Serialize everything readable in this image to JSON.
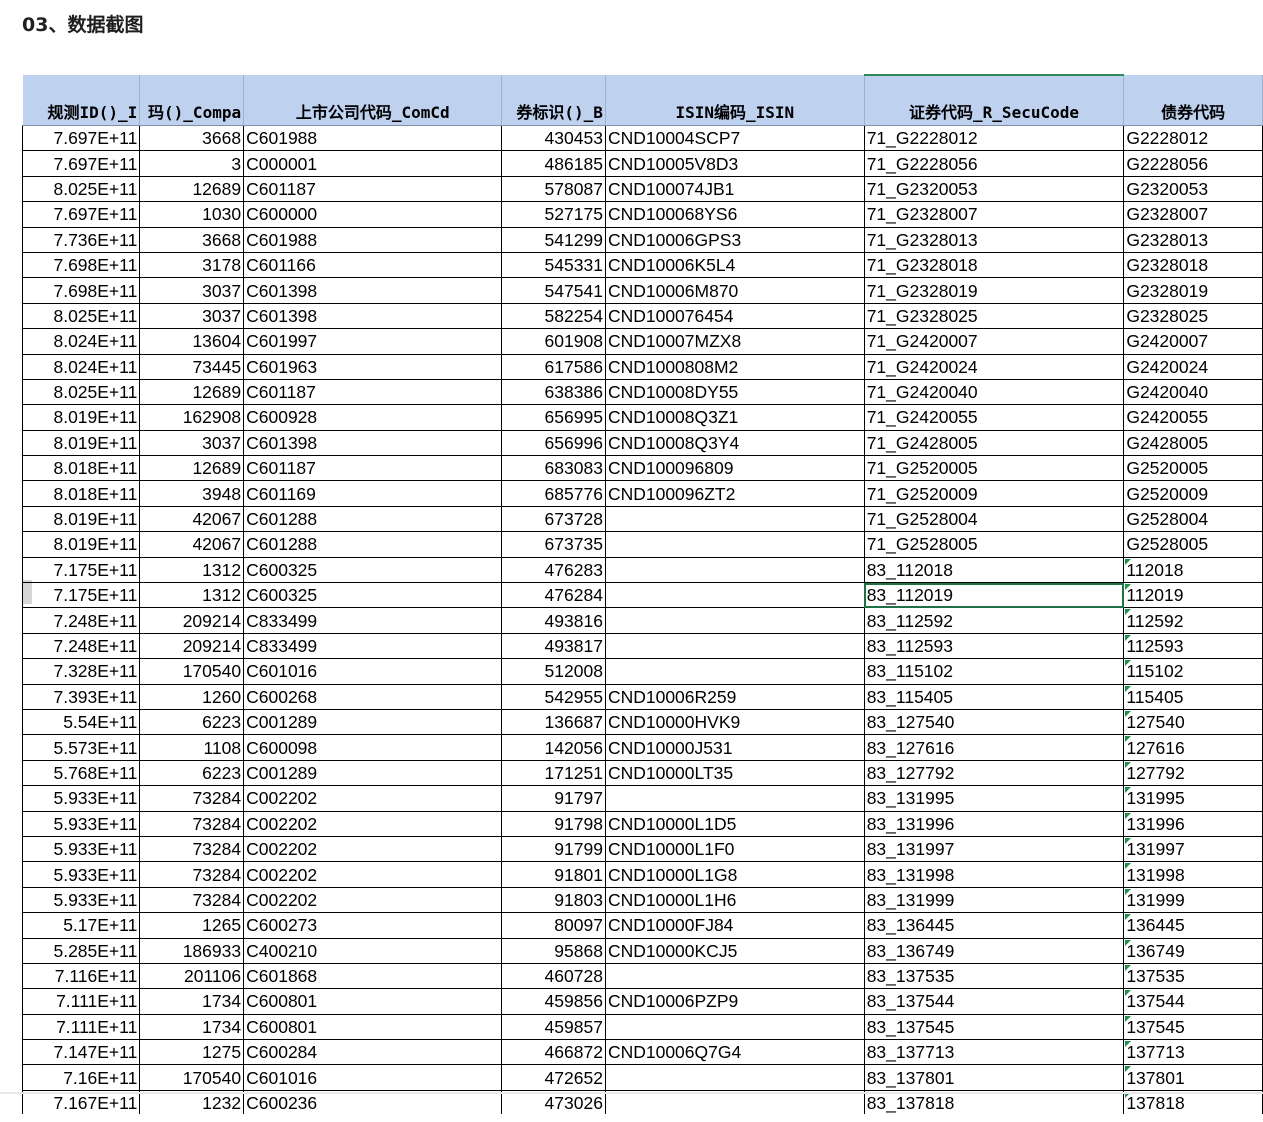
{
  "page_title": "03、数据截图",
  "table": {
    "headers": [
      "规测ID()_I",
      "玛()_Compa",
      "上市公司代码_ComCd",
      "券标识()_B",
      "ISIN编码_ISIN",
      "证券代码_R_SecuCode",
      "债券代码"
    ],
    "rows": [
      [
        "7.697E+11",
        "3668",
        "C601988",
        "430453",
        "CND10004SCP7",
        "71_G2228012",
        "G2228012"
      ],
      [
        "7.697E+11",
        "3",
        "C000001",
        "486185",
        "CND10005V8D3",
        "71_G2228056",
        "G2228056"
      ],
      [
        "8.025E+11",
        "12689",
        "C601187",
        "578087",
        "CND100074JB1",
        "71_G2320053",
        "G2320053"
      ],
      [
        "7.697E+11",
        "1030",
        "C600000",
        "527175",
        "CND100068YS6",
        "71_G2328007",
        "G2328007"
      ],
      [
        "7.736E+11",
        "3668",
        "C601988",
        "541299",
        "CND10006GPS3",
        "71_G2328013",
        "G2328013"
      ],
      [
        "7.698E+11",
        "3178",
        "C601166",
        "545331",
        "CND10006K5L4",
        "71_G2328018",
        "G2328018"
      ],
      [
        "7.698E+11",
        "3037",
        "C601398",
        "547541",
        "CND10006M870",
        "71_G2328019",
        "G2328019"
      ],
      [
        "8.025E+11",
        "3037",
        "C601398",
        "582254",
        "CND100076454",
        "71_G2328025",
        "G2328025"
      ],
      [
        "8.024E+11",
        "13604",
        "C601997",
        "601908",
        "CND10007MZX8",
        "71_G2420007",
        "G2420007"
      ],
      [
        "8.024E+11",
        "73445",
        "C601963",
        "617586",
        "CND1000808M2",
        "71_G2420024",
        "G2420024"
      ],
      [
        "8.025E+11",
        "12689",
        "C601187",
        "638386",
        "CND10008DY55",
        "71_G2420040",
        "G2420040"
      ],
      [
        "8.019E+11",
        "162908",
        "C600928",
        "656995",
        "CND10008Q3Z1",
        "71_G2420055",
        "G2420055"
      ],
      [
        "8.019E+11",
        "3037",
        "C601398",
        "656996",
        "CND10008Q3Y4",
        "71_G2428005",
        "G2428005"
      ],
      [
        "8.018E+11",
        "12689",
        "C601187",
        "683083",
        "CND100096809",
        "71_G2520005",
        "G2520005"
      ],
      [
        "8.018E+11",
        "3948",
        "C601169",
        "685776",
        "CND100096ZT2",
        "71_G2520009",
        "G2520009"
      ],
      [
        "8.019E+11",
        "42067",
        "C601288",
        "673728",
        "",
        "71_G2528004",
        "G2528004"
      ],
      [
        "8.019E+11",
        "42067",
        "C601288",
        "673735",
        "",
        "71_G2528005",
        "G2528005"
      ],
      [
        "7.175E+11",
        "1312",
        "C600325",
        "476283",
        "",
        "83_112018",
        "112018"
      ],
      [
        "7.175E+11",
        "1312",
        "C600325",
        "476284",
        "",
        "83_112019",
        "112019"
      ],
      [
        "7.248E+11",
        "209214",
        "C833499",
        "493816",
        "",
        "83_112592",
        "112592"
      ],
      [
        "7.248E+11",
        "209214",
        "C833499",
        "493817",
        "",
        "83_112593",
        "112593"
      ],
      [
        "7.328E+11",
        "170540",
        "C601016",
        "512008",
        "",
        "83_115102",
        "115102"
      ],
      [
        "7.393E+11",
        "1260",
        "C600268",
        "542955",
        "CND10006R259",
        "83_115405",
        "115405"
      ],
      [
        "5.54E+11",
        "6223",
        "C001289",
        "136687",
        "CND10000HVK9",
        "83_127540",
        "127540"
      ],
      [
        "5.573E+11",
        "1108",
        "C600098",
        "142056",
        "CND10000J531",
        "83_127616",
        "127616"
      ],
      [
        "5.768E+11",
        "6223",
        "C001289",
        "171251",
        "CND10000LT35",
        "83_127792",
        "127792"
      ],
      [
        "5.933E+11",
        "73284",
        "C002202",
        "91797",
        "",
        "83_131995",
        "131995"
      ],
      [
        "5.933E+11",
        "73284",
        "C002202",
        "91798",
        "CND10000L1D5",
        "83_131996",
        "131996"
      ],
      [
        "5.933E+11",
        "73284",
        "C002202",
        "91799",
        "CND10000L1F0",
        "83_131997",
        "131997"
      ],
      [
        "5.933E+11",
        "73284",
        "C002202",
        "91801",
        "CND10000L1G8",
        "83_131998",
        "131998"
      ],
      [
        "5.933E+11",
        "73284",
        "C002202",
        "91803",
        "CND10000L1H6",
        "83_131999",
        "131999"
      ],
      [
        "5.17E+11",
        "1265",
        "C600273",
        "80097",
        "CND10000FJ84",
        "83_136445",
        "136445"
      ],
      [
        "5.285E+11",
        "186933",
        "C400210",
        "95868",
        "CND10000KCJ5",
        "83_136749",
        "136749"
      ],
      [
        "7.116E+11",
        "201106",
        "C601868",
        "460728",
        "",
        "83_137535",
        "137535"
      ],
      [
        "7.111E+11",
        "1734",
        "C600801",
        "459856",
        "CND10006PZP9",
        "83_137544",
        "137544"
      ],
      [
        "7.111E+11",
        "1734",
        "C600801",
        "459857",
        "",
        "83_137545",
        "137545"
      ],
      [
        "7.147E+11",
        "1275",
        "C600284",
        "466872",
        "CND10006Q7G4",
        "83_137713",
        "137713"
      ],
      [
        "7.16E+11",
        "170540",
        "C601016",
        "472652",
        "",
        "83_137801",
        "137801"
      ],
      [
        "7.167E+11",
        "1232",
        "C600236",
        "473026",
        "",
        "83_137818",
        "137818"
      ]
    ],
    "selected_cell": {
      "row": 18,
      "col": 5
    },
    "colors": {
      "header_bg": "#bed1ef",
      "selection": "#1e7145",
      "text_marker": "#1e8f4e"
    }
  }
}
